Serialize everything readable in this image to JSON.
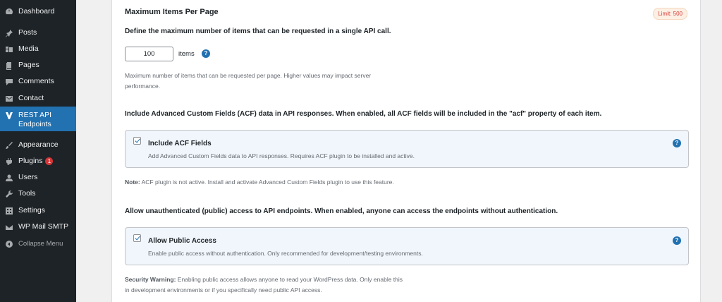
{
  "sidebar": {
    "items": [
      {
        "label": "Dashboard",
        "icon": "dashboard-icon"
      },
      {
        "label": "Posts",
        "icon": "pin-icon"
      },
      {
        "label": "Media",
        "icon": "media-icon"
      },
      {
        "label": "Pages",
        "icon": "pages-icon"
      },
      {
        "label": "Comments",
        "icon": "comments-icon"
      },
      {
        "label": "Contact",
        "icon": "mail-icon"
      },
      {
        "label": "REST API Endpoints",
        "icon": "rest-api-icon",
        "active": true
      },
      {
        "label": "Appearance",
        "icon": "brush-icon"
      },
      {
        "label": "Plugins",
        "icon": "plugin-icon",
        "badge": "1"
      },
      {
        "label": "Users",
        "icon": "users-icon"
      },
      {
        "label": "Tools",
        "icon": "wrench-icon"
      },
      {
        "label": "Settings",
        "icon": "settings-icon"
      },
      {
        "label": "WP Mail SMTP",
        "icon": "smtp-icon"
      },
      {
        "label": "Collapse Menu",
        "icon": "collapse-icon"
      }
    ]
  },
  "max_items": {
    "title": "Maximum Items Per Page",
    "limit_badge": "Limit: 500",
    "description": "Define the maximum number of items that can be requested in a single API call.",
    "value": "100",
    "unit": "items",
    "hint_line1": "Maximum number of items that can be requested per page. Higher values may impact server",
    "hint_line2": "performance."
  },
  "acf": {
    "description": "Include Advanced Custom Fields (ACF) data in API responses. When enabled, all ACF fields will be included in the \"acf\" property of each item.",
    "option_title": "Include ACF Fields",
    "option_desc": "Add Advanced Custom Fields data to API responses. Requires ACF plugin to be installed and active.",
    "checked": true,
    "note_label": "Note:",
    "note_text": " ACF plugin is not active. Install and activate Advanced Custom Fields plugin to use this feature."
  },
  "public_access": {
    "description": "Allow unauthenticated (public) access to API endpoints. When enabled, anyone can access the endpoints without authentication.",
    "option_title": "Allow Public Access",
    "option_desc": "Enable public access without authentication. Only recommended for development/testing environments.",
    "checked": true,
    "warning_label": "Security Warning:",
    "warning_line1": " Enabling public access allows anyone to read your WordPress data. Only enable this",
    "warning_line2": "in development environments or if you specifically need public API access."
  },
  "help_glyph": "?",
  "colors": {
    "accent": "#2271b1",
    "sidebar_bg": "#1d2327",
    "badge_red": "#d63638",
    "option_bg": "#f0f6fc"
  }
}
